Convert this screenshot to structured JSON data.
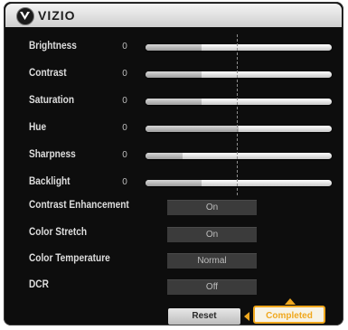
{
  "header": {
    "brand": "VIZIO",
    "logo_icon": "vizio-v-logo-icon"
  },
  "sliders": [
    {
      "label": "Brightness",
      "value": "0",
      "level": 0.3
    },
    {
      "label": "Contrast",
      "value": "0",
      "level": 0.3
    },
    {
      "label": "Saturation",
      "value": "0",
      "level": 0.3
    },
    {
      "label": "Hue",
      "value": "0",
      "level": 0.5
    },
    {
      "label": "Sharpness",
      "value": "0",
      "level": 0.2
    },
    {
      "label": "Backlight",
      "value": "0",
      "level": 0.3
    }
  ],
  "options": [
    {
      "label": "Contrast Enhancement",
      "value": "On"
    },
    {
      "label": "Color Stretch",
      "value": "On"
    },
    {
      "label": "Color Temperature",
      "value": "Normal"
    },
    {
      "label": "DCR",
      "value": "Off"
    }
  ],
  "buttons": {
    "reset": "Reset",
    "completed": "Completed"
  },
  "colors": {
    "background": "#0d0d0d",
    "highlight": "#f0a81e",
    "label_text": "#dedede",
    "option_box": "#3b3b3b"
  }
}
